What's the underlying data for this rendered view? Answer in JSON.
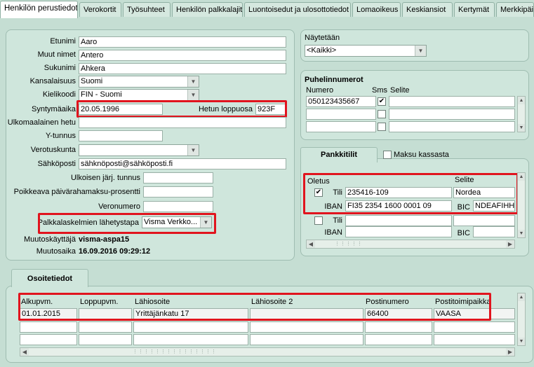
{
  "tabs": [
    "Henkilön perustiedot",
    "Verokortit",
    "Työsuhteet",
    "Henkilön palkkalajit",
    "Luontoisedut ja ulosottotiedot",
    "Lomaoikeus",
    "Keskiansiot",
    "Kertymät",
    "Merkkipäivät"
  ],
  "person": {
    "etunimi_label": "Etunimi",
    "etunimi": "Aaro",
    "muut_nimet_label": "Muut nimet",
    "muut_nimet": "Antero",
    "sukunimi_label": "Sukunimi",
    "sukunimi": "Ahkera",
    "kansalaisuus_label": "Kansalaisuus",
    "kansalaisuus": "Suomi",
    "kielikoodi_label": "Kielikoodi",
    "kielikoodi": "FIN - Suomi",
    "syntymaaika_label": "Syntymäaika",
    "syntymaaika": "20.05.1996",
    "hetun_label": "Hetun loppuosa",
    "hetun": "923F",
    "ulkomaalainen_label": "Ulkomaalainen hetu",
    "ulkomaalainen": "",
    "ytunnus_label": "Y-tunnus",
    "ytunnus": "",
    "verotuskunta_label": "Verotuskunta",
    "verotuskunta": "",
    "sahkoposti_label": "Sähköposti",
    "sahkoposti": "sähknöposti@sähköposti.fi",
    "ulkoisen_label": "Ulkoisen järj. tunnus",
    "ulkoisen": "",
    "poikkeava_label": "Poikkeava päivärahamaksu-prosentti",
    "poikkeava": "",
    "veronumero_label": "Veronumero",
    "veronumero": "",
    "palkkalaskelman_label": "Palkkalaskelmien lähetystapa",
    "palkkalaskelman": "Visma Verkko...",
    "muutoskayttaja_label": "Muutoskäyttäjä",
    "muutoskayttaja": "visma-aspa15",
    "muutosaika_label": "Muutosaika",
    "muutosaika": "16.09.2016 09:29:12"
  },
  "naytetaan": {
    "label": "Näytetään",
    "value": "<Kaikki>"
  },
  "phones": {
    "title": "Puhelinnumerot",
    "col_numero": "Numero",
    "col_sms": "Sms",
    "col_selite": "Selite",
    "rows": [
      {
        "numero": "050123435667",
        "sms": "✔",
        "selite": ""
      },
      {
        "numero": "",
        "sms": "",
        "selite": ""
      },
      {
        "numero": "",
        "sms": "",
        "selite": ""
      }
    ]
  },
  "bank": {
    "tab_label": "Pankkitilit",
    "maksu_kassasta": "Maksu kassasta",
    "col_oletus": "Oletus",
    "col_selite": "Selite",
    "tili_label": "Tili",
    "iban_label": "IBAN",
    "bic_label": "BIC",
    "row1": {
      "check": "✔",
      "tili": "235416-109",
      "selite": "Nordea",
      "iban": "FI35 2354 1600 0001 09",
      "bic": "NDEAFIHH"
    },
    "row2": {
      "check": "",
      "tili": "",
      "selite": "",
      "iban": "",
      "bic": ""
    }
  },
  "address": {
    "tab_label": "Osoitetiedot",
    "cols": [
      "Alkupvm.",
      "Loppupvm.",
      "Lähiosoite",
      "Lähiosoite 2",
      "Postinumero",
      "Postitoimipaikka"
    ],
    "rows": [
      [
        "01.01.2015",
        "",
        "Yrittäjänkatu 17",
        "",
        "66400",
        "VAASA"
      ],
      [
        "",
        "",
        "",
        "",
        "",
        ""
      ],
      [
        "",
        "",
        "",
        "",
        "",
        ""
      ]
    ]
  },
  "colors": {
    "background": "#c5ded3",
    "highlight": "#e1141e"
  }
}
